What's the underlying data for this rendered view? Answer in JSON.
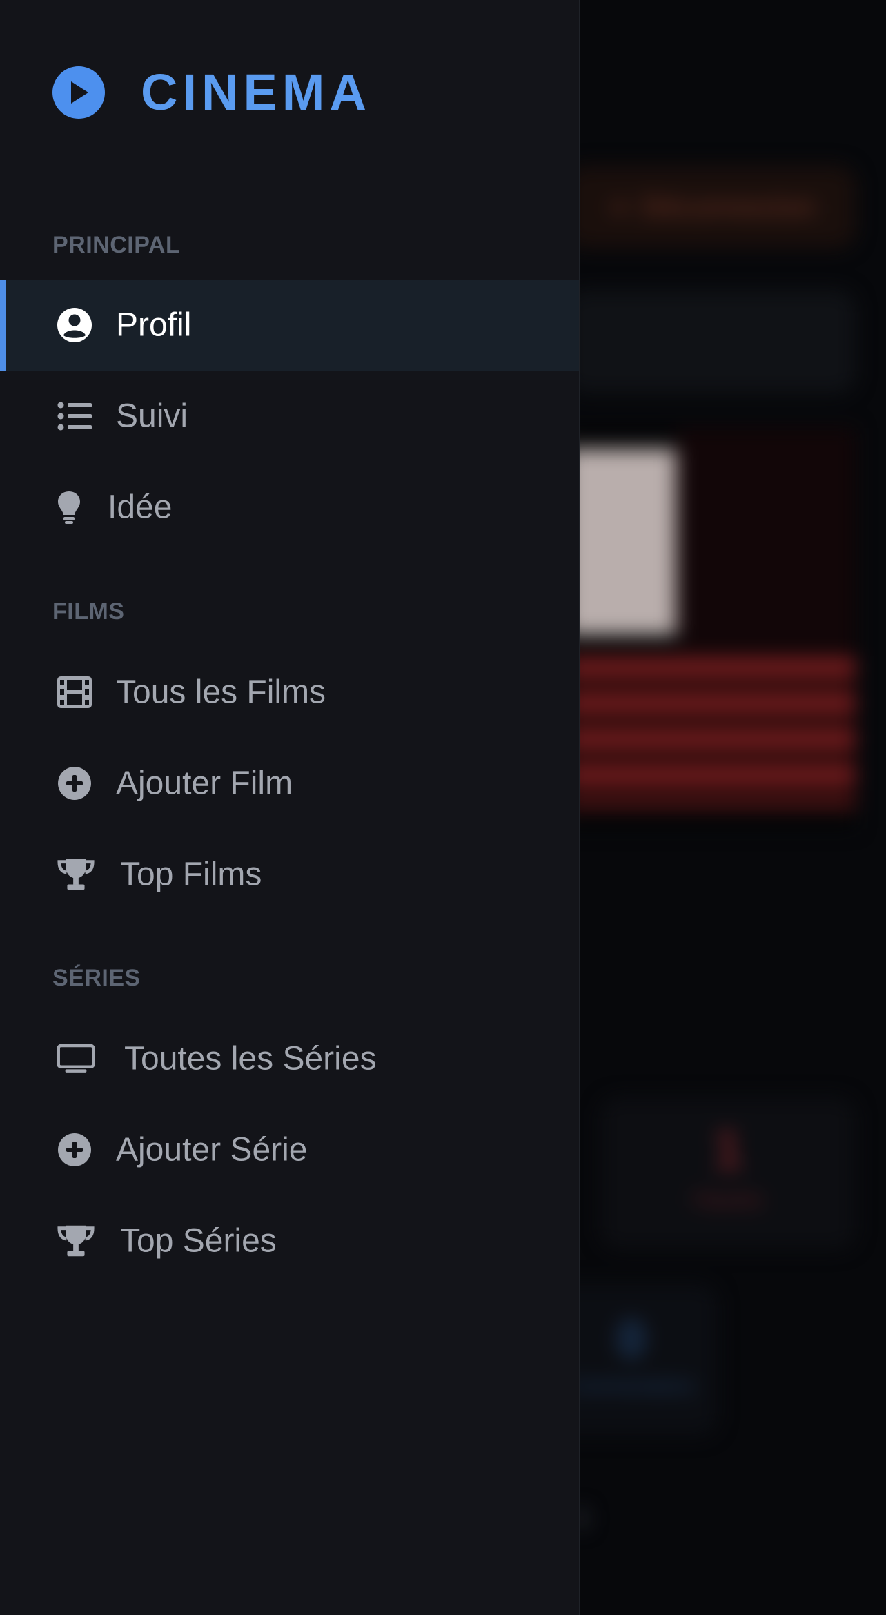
{
  "colors": {
    "accent": "#4d90ee",
    "drawer_bg": "#131419",
    "active_bg": "#182029",
    "section_label": "#5d6573",
    "item_text": "#a3a7b0",
    "active_text": "#ffffff"
  },
  "brand": {
    "title": "CINEMA",
    "icon": "play-circle-icon"
  },
  "sections": {
    "principal": {
      "label": "PRINCIPAL",
      "items": [
        {
          "label": "Profil",
          "icon": "user-circle-icon",
          "active": true
        },
        {
          "label": "Suivi",
          "icon": "list-icon",
          "active": false
        },
        {
          "label": "Idée",
          "icon": "lightbulb-icon",
          "active": false
        }
      ]
    },
    "films": {
      "label": "FILMS",
      "items": [
        {
          "label": "Tous les Films",
          "icon": "film-icon"
        },
        {
          "label": "Ajouter Film",
          "icon": "plus-circle-icon"
        },
        {
          "label": "Top Films",
          "icon": "trophy-icon"
        }
      ]
    },
    "series": {
      "label": "SÉRIES",
      "items": [
        {
          "label": "Toutes les Séries",
          "icon": "tv-icon"
        },
        {
          "label": "Ajouter Série",
          "icon": "plus-circle-icon"
        },
        {
          "label": "Top Séries",
          "icon": "trophy-icon"
        }
      ]
    }
  },
  "background_page": {
    "logout_label": "Déconnexion",
    "stat_1_value": "1",
    "stat_1_label": "Favoris",
    "stat_2_value": "0",
    "stat_2_label": "Commentaires"
  }
}
